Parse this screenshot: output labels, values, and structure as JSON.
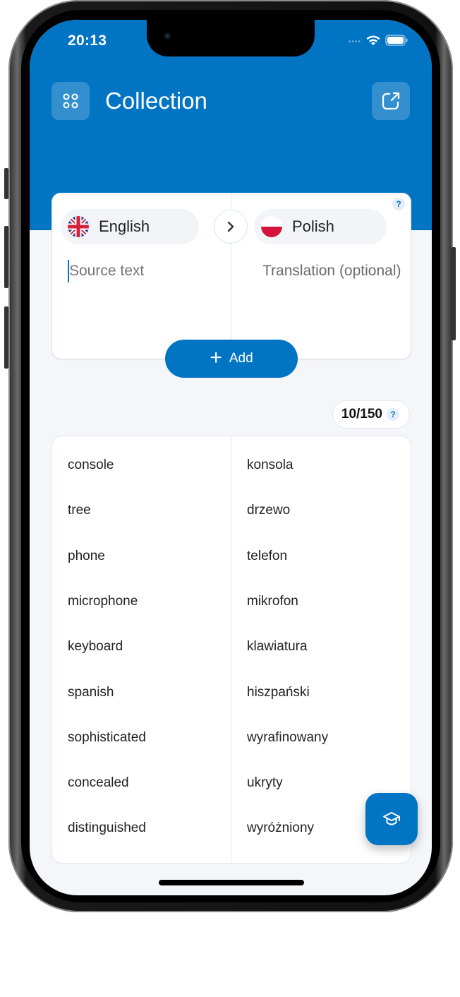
{
  "status_bar": {
    "time": "20:13",
    "signal_icon": "signal-dots",
    "wifi_icon": "wifi-icon",
    "battery_icon": "battery-icon"
  },
  "header": {
    "title": "Collection",
    "menu_icon": "four-dots-icon",
    "share_icon": "external-share-icon"
  },
  "translator": {
    "help_label": "?",
    "source_language": "English",
    "source_flag": "uk-flag-icon",
    "target_language": "Polish",
    "target_flag": "poland-flag-icon",
    "swap_icon": "chevron-right-icon",
    "source_value": "",
    "source_placeholder": "Source text",
    "translation_placeholder": "Translation (optional)",
    "add_icon": "+",
    "add_label": "Add"
  },
  "counter": {
    "text": "10/150",
    "help_label": "?"
  },
  "words": [
    {
      "source": "console",
      "translation": "konsola"
    },
    {
      "source": "tree",
      "translation": "drzewo"
    },
    {
      "source": "phone",
      "translation": "telefon"
    },
    {
      "source": "microphone",
      "translation": "mikrofon"
    },
    {
      "source": "keyboard",
      "translation": "klawiatura"
    },
    {
      "source": "spanish",
      "translation": "hiszpański"
    },
    {
      "source": "sophisticated",
      "translation": "wyrafinowany"
    },
    {
      "source": "concealed",
      "translation": "ukryty"
    },
    {
      "source": "distinguished",
      "translation": "wyróżniony"
    }
  ],
  "fab": {
    "icon": "graduation-cap-icon"
  },
  "colors": {
    "accent": "#0274C4",
    "background": "#F4F6FA",
    "card": "#FFFFFF",
    "text": "#222222"
  }
}
